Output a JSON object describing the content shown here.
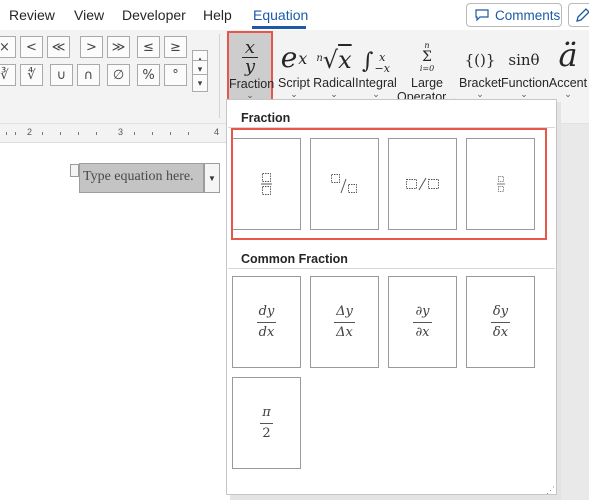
{
  "tabs": [
    {
      "label": "Review",
      "active": false
    },
    {
      "label": "View",
      "active": false
    },
    {
      "label": "Developer",
      "active": false
    },
    {
      "label": "Help",
      "active": false
    },
    {
      "label": "Equation",
      "active": true
    }
  ],
  "toolbar": {
    "comments_label": "Comments"
  },
  "symbols": {
    "row1": [
      "×",
      "<",
      "≪",
      ">",
      "≫",
      "≤",
      "≥"
    ],
    "row2": [
      "∛",
      "∜",
      "∪",
      "∩",
      "∅",
      "%",
      "°"
    ]
  },
  "ribbon_buttons": [
    {
      "label": "Fraction",
      "glyph_top": "x",
      "glyph_bottom": "y",
      "selected": true
    },
    {
      "label": "Script",
      "glyph": "eˣ"
    },
    {
      "label": "Radical",
      "glyph": "ⁿ√x"
    },
    {
      "label": "Integral",
      "glyph": "∫"
    },
    {
      "label": "Large",
      "label2": "Operator",
      "glyph": "Σ"
    },
    {
      "label": "Bracket",
      "glyph": "{()}"
    },
    {
      "label": "Function",
      "glyph": "sinθ"
    },
    {
      "label": "Accent",
      "glyph": "ä"
    }
  ],
  "ruler": {
    "labels": [
      "2",
      "3",
      "4"
    ]
  },
  "document": {
    "equation_placeholder": "Type equation here."
  },
  "gallery": {
    "fraction_title": "Fraction",
    "fraction_items": [
      {
        "name": "stacked-fraction",
        "text": "□/□ stacked"
      },
      {
        "name": "skewed-fraction",
        "text": "□/□ skewed"
      },
      {
        "name": "linear-fraction",
        "text": "□/□"
      },
      {
        "name": "small-fraction",
        "text": "□/□ small"
      }
    ],
    "common_title": "Common Fraction",
    "common_items": [
      {
        "num": "dy",
        "den": "dx"
      },
      {
        "num": "Δy",
        "den": "Δx"
      },
      {
        "num": "∂y",
        "den": "∂x"
      },
      {
        "num": "δy",
        "den": "δx"
      },
      {
        "num": "π",
        "den": "2"
      }
    ]
  },
  "colors": {
    "accent": "#1d5aa6",
    "highlight": "#e8564b",
    "selected_bg": "#cdcdcd"
  }
}
